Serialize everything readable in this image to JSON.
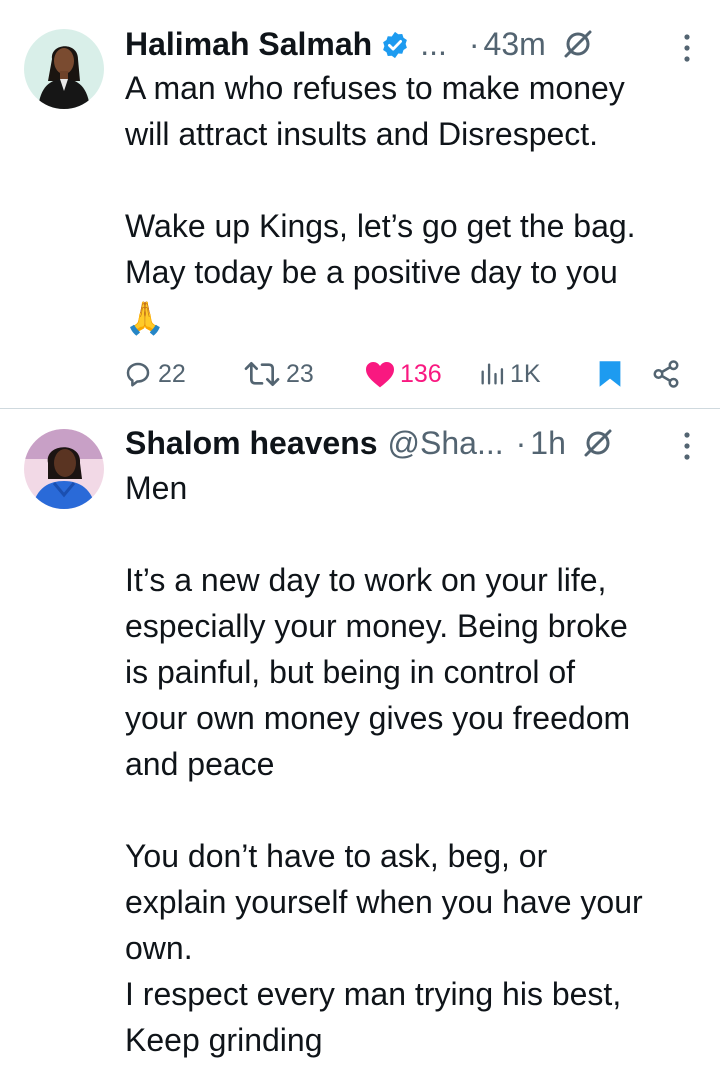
{
  "tweets": [
    {
      "author_name": "Halimah Salmah",
      "verified": true,
      "handle": "...",
      "separator": "·",
      "time": "43m",
      "text": "A man who refuses to make money\nwill attract insults and Disrespect.\n\nWake up Kings, let’s go get the bag.\nMay today be a positive day to you\n🙏",
      "stats": {
        "replies": "22",
        "retweets": "23",
        "likes": "136",
        "views": "1K"
      },
      "liked": true,
      "bookmarked": true
    },
    {
      "author_name": "Shalom heavens",
      "verified": false,
      "handle": "@Sha...",
      "separator": "·",
      "time": "1h",
      "text": "Men\n\nIt’s a new day to work on your life,\nespecially your money. Being broke\nis painful, but being in control of\nyour own money gives you freedom\nand peace\n\nYou don’t have to ask, beg, or\nexplain yourself when you have your\nown.\nI respect every man trying his best,\nKeep grinding"
    }
  ],
  "colors": {
    "text": "#0f1419",
    "secondary": "#536471",
    "like": "#f91880",
    "verified": "#1d9bf0",
    "bookmark": "#1d9bf0",
    "divider": "#cfd9de"
  },
  "icons": {
    "reply": "reply-icon",
    "retweet": "retweet-icon",
    "like": "heart-icon",
    "views": "views-icon",
    "bookmark": "bookmark-icon",
    "share": "share-icon",
    "grok": "grok-icon",
    "more": "more-icon",
    "verified": "verified-badge-icon"
  }
}
